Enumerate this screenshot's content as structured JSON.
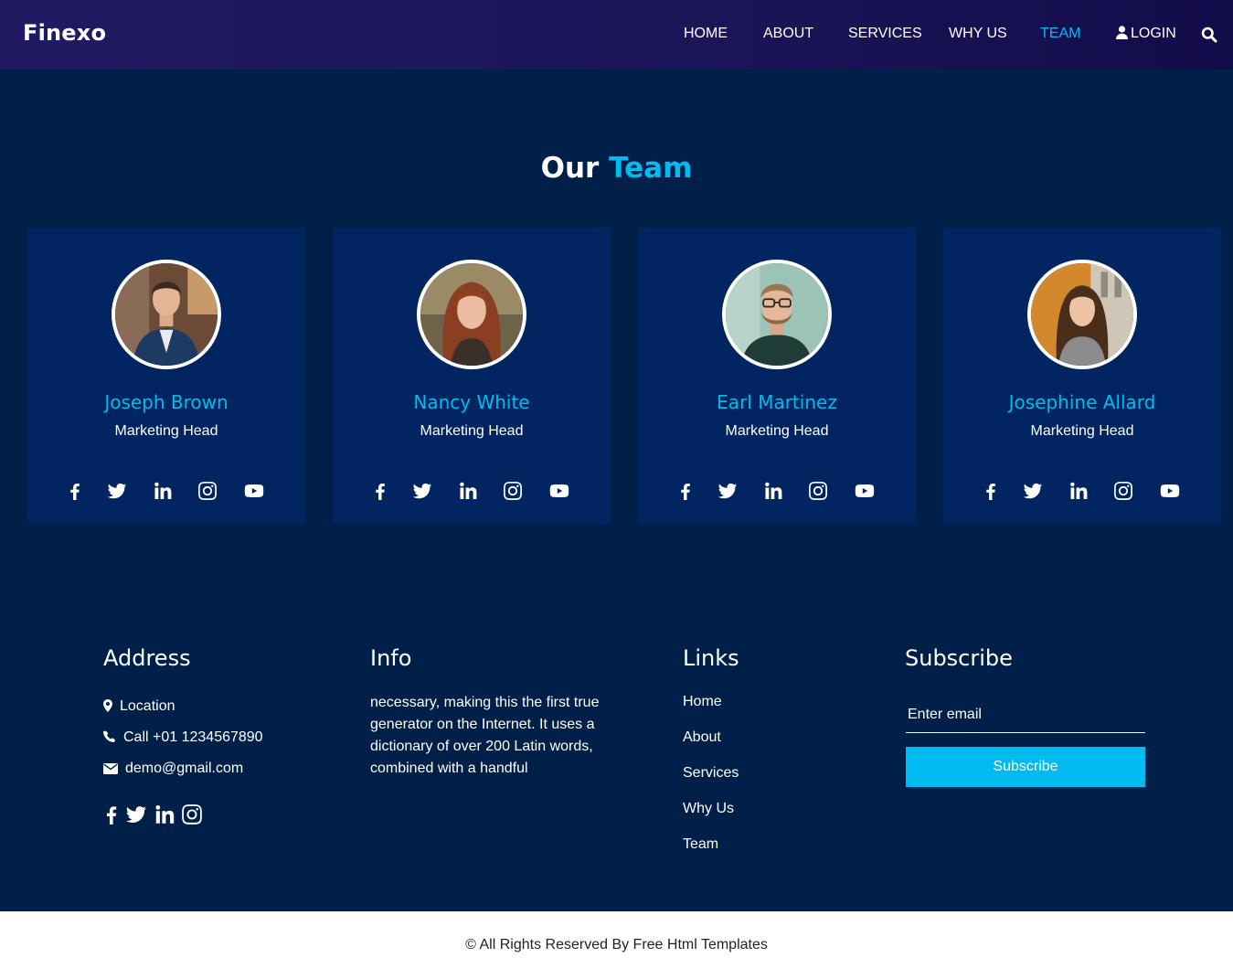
{
  "brand": "Finexo",
  "nav": {
    "items": [
      "HOME",
      "ABOUT",
      "SERVICES",
      "WHY US",
      "TEAM"
    ],
    "active": "TEAM",
    "login": "LOGIN",
    "icons": {
      "login": "user-icon",
      "search": "search-icon"
    }
  },
  "colors": {
    "accent": "#00bbf0",
    "background": "#00204a",
    "card": "#002560",
    "header_start": "#211a63",
    "header_end": "#130c4b"
  },
  "team": {
    "title": "Our",
    "title_highlight": "Team",
    "members": [
      {
        "name": "Joseph Brown",
        "role": "Marketing Head",
        "avatar": "man-in-suit-photo"
      },
      {
        "name": "Nancy White",
        "role": "Marketing Head",
        "avatar": "woman-red-hair-photo"
      },
      {
        "name": "Earl Martinez",
        "role": "Marketing Head",
        "avatar": "man-glasses-beard-photo"
      },
      {
        "name": "Josephine Allard",
        "role": "Marketing Head",
        "avatar": "woman-brown-hair-photo"
      }
    ],
    "social_icons": [
      "facebook-icon",
      "twitter-icon",
      "linkedin-icon",
      "instagram-icon",
      "youtube-icon"
    ]
  },
  "footer": {
    "address": {
      "heading": "Address",
      "location": "Location",
      "phone": "Call +01 1234567890",
      "email": "demo@gmail.com",
      "social_icons": [
        "facebook-icon",
        "twitter-icon",
        "linkedin-icon",
        "instagram-icon"
      ]
    },
    "info": {
      "heading": "Info",
      "text": "necessary, making this the first true generator on the Internet. It uses a dictionary of over 200 Latin words, combined with a handful"
    },
    "links": {
      "heading": "Links",
      "items": [
        "Home",
        "About",
        "Services",
        "Why Us",
        "Team"
      ]
    },
    "subscribe": {
      "heading": "Subscribe",
      "placeholder": "Enter email",
      "button": "Subscribe"
    }
  },
  "copyright": "© All Rights Reserved By Free Html Templates"
}
